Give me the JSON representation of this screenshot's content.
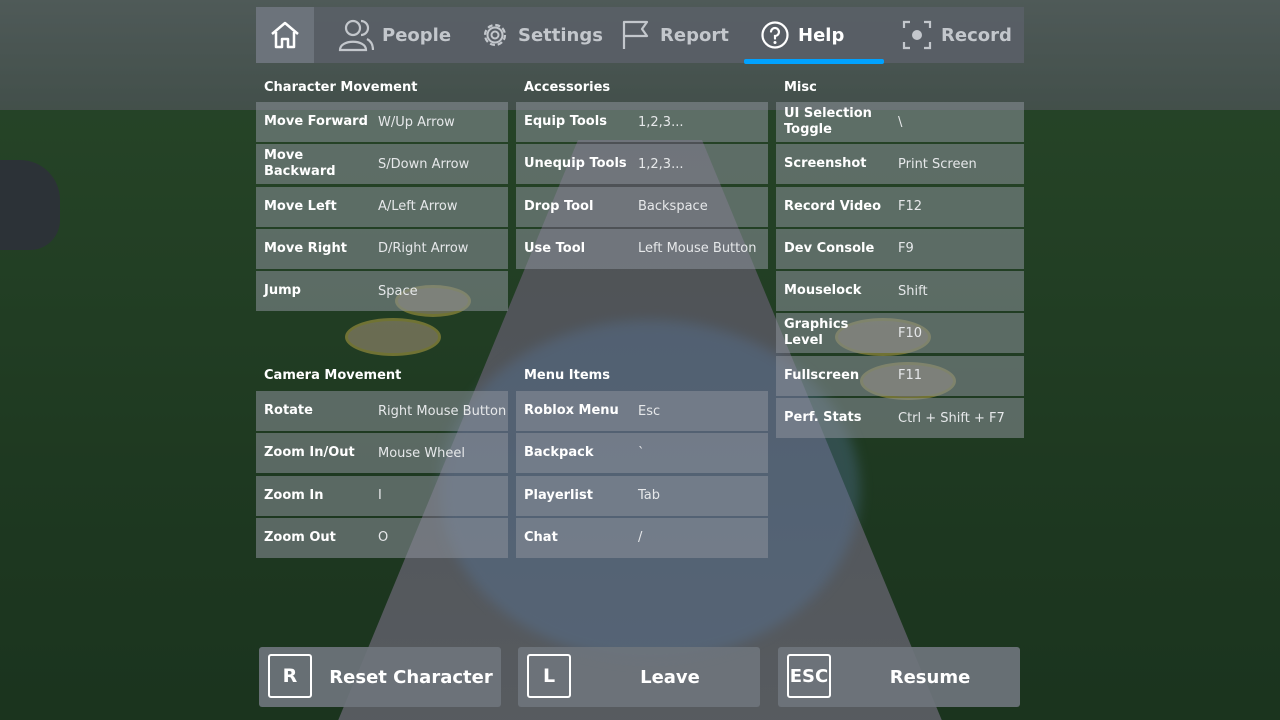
{
  "tabs": [
    {
      "label": "People",
      "icon": "people-icon"
    },
    {
      "label": "Settings",
      "icon": "gear-icon"
    },
    {
      "label": "Report",
      "icon": "flag-icon"
    },
    {
      "label": "Help",
      "icon": "help-icon",
      "active": true
    },
    {
      "label": "Record",
      "icon": "record-icon"
    }
  ],
  "sections": {
    "character_movement": {
      "title": "Character Movement",
      "rows": [
        {
          "key": "Move Forward",
          "value": "W/Up Arrow"
        },
        {
          "key": "Move Backward",
          "value": "S/Down Arrow"
        },
        {
          "key": "Move Left",
          "value": "A/Left Arrow"
        },
        {
          "key": "Move Right",
          "value": "D/Right Arrow"
        },
        {
          "key": "Jump",
          "value": "Space"
        }
      ]
    },
    "camera_movement": {
      "title": "Camera Movement",
      "rows": [
        {
          "key": "Rotate",
          "value": "Right Mouse Button"
        },
        {
          "key": "Zoom In/Out",
          "value": "Mouse Wheel"
        },
        {
          "key": "Zoom In",
          "value": "I"
        },
        {
          "key": "Zoom Out",
          "value": "O"
        }
      ]
    },
    "accessories": {
      "title": "Accessories",
      "rows": [
        {
          "key": "Equip Tools",
          "value": "1,2,3..."
        },
        {
          "key": "Unequip Tools",
          "value": "1,2,3..."
        },
        {
          "key": "Drop Tool",
          "value": "Backspace"
        },
        {
          "key": "Use Tool",
          "value": "Left Mouse Button"
        }
      ]
    },
    "menu_items": {
      "title": "Menu Items",
      "rows": [
        {
          "key": "Roblox Menu",
          "value": "Esc"
        },
        {
          "key": "Backpack",
          "value": "`"
        },
        {
          "key": "Playerlist",
          "value": "Tab"
        },
        {
          "key": "Chat",
          "value": "/"
        }
      ]
    },
    "misc": {
      "title": "Misc",
      "rows": [
        {
          "key": "UI Selection Toggle",
          "value": "\\"
        },
        {
          "key": "Screenshot",
          "value": "Print Screen"
        },
        {
          "key": "Record Video",
          "value": "F12"
        },
        {
          "key": "Dev Console",
          "value": "F9"
        },
        {
          "key": "Mouselock",
          "value": "Shift"
        },
        {
          "key": "Graphics Level",
          "value": "F10"
        },
        {
          "key": "Fullscreen",
          "value": "F11"
        },
        {
          "key": "Perf. Stats",
          "value": "Ctrl + Shift + F7"
        }
      ]
    }
  },
  "buttons": {
    "reset": {
      "key": "R",
      "label": "Reset Character"
    },
    "leave": {
      "key": "L",
      "label": "Leave"
    },
    "resume": {
      "key": "ESC",
      "label": "Resume"
    }
  },
  "colors": {
    "accent": "#00a2ff"
  }
}
